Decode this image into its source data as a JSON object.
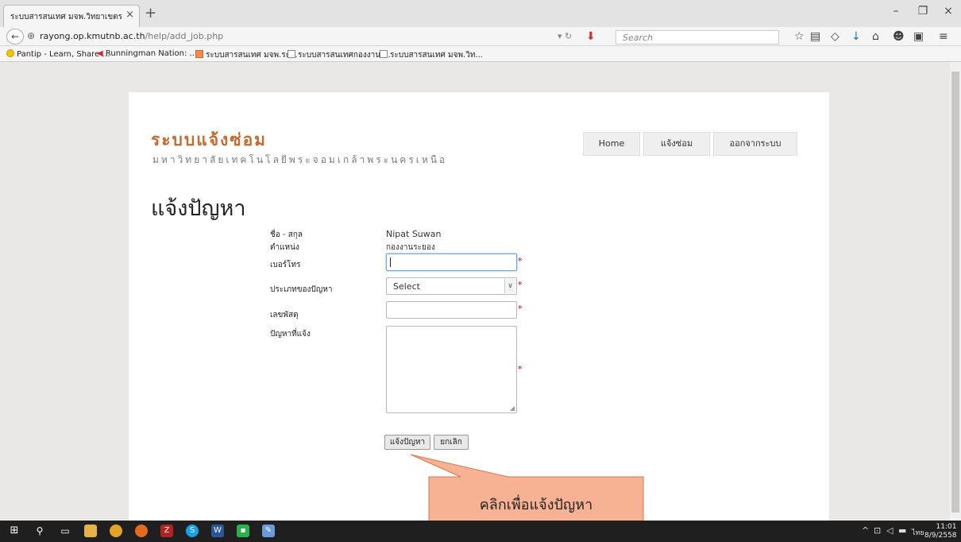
{
  "browser": {
    "tab_title": "ระบบสารสนเทศ มจพ.วิทยาเขตระ...",
    "url_host": "rayong.op.kmutnb.ac.th",
    "url_path": "/help/add_job.php",
    "search_placeholder": "Search",
    "bookmarks": [
      "Pantip - Learn, Share ...",
      "Runningman Nation: ...",
      "ระบบสารสนเทศ มจพ.ระ...",
      "ระบบสารสนเทศกองงาน ...",
      "ระบบสารสนเทศ มจพ.วิท..."
    ]
  },
  "site": {
    "title": "ระบบแจ้งซ่อม",
    "subtitle": "มหาวิทยาลัยเทคโนโลยีพระจอมเกล้าพระนครเหนือ",
    "nav": [
      "Home",
      "แจ้งซ่อม",
      "ออกจากระบบ"
    ]
  },
  "page": {
    "title": "แจ้งปัญหา",
    "labels": {
      "name": "ชื่อ - สกุล",
      "position": "ตำแหน่ง",
      "phone": "เบอร์โทร",
      "type": "ประเภทของปัญหา",
      "parcel": "เลขพัสดุ",
      "problem": "ปัญหาที่แจ้ง"
    },
    "values": {
      "name": "Nipat   Suwan",
      "position": "กองงานระยอง",
      "type_selected": "Select"
    },
    "required_mark": "*",
    "submit_label": "แจ้งปัญหา",
    "cancel_label": "ยกเลิก"
  },
  "callout": {
    "text": "คลิกเพื่อแจ้งปัญหา",
    "fill": "#f7b193",
    "stroke": "#d9794f"
  },
  "taskbar": {
    "language": "ไทย",
    "time": "11:01",
    "date": "8/9/2558"
  }
}
